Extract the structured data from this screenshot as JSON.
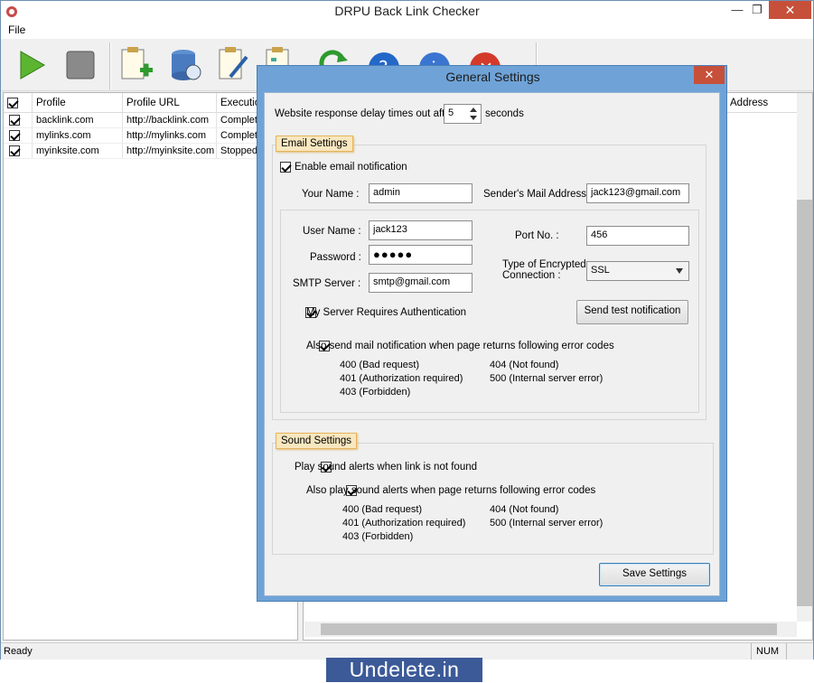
{
  "window": {
    "title": "DRPU Back Link Checker",
    "min_glyph": "—",
    "max_glyph": "❐",
    "close_glyph": "✕"
  },
  "menu": {
    "file": "File"
  },
  "toolbar": {
    "icons": [
      "start-icon",
      "stop-icon",
      "add-profile-icon",
      "database-icon",
      "edit-profile-icon",
      "report-icon",
      "refresh-icon",
      "help-icon",
      "about-icon",
      "exit-icon"
    ]
  },
  "grid": {
    "headers": {
      "profile": "Profile",
      "url": "Profile URL",
      "execution": "Executio",
      "address": "Address"
    },
    "rows": [
      {
        "checked": true,
        "profile": "backlink.com",
        "url": "http://backlink.com",
        "status": "Complete"
      },
      {
        "checked": true,
        "profile": "mylinks.com",
        "url": "http://mylinks.com",
        "status": "Complete"
      },
      {
        "checked": true,
        "profile": "myinksite.com",
        "url": "http://myinksite.com",
        "status": "Stopped"
      }
    ]
  },
  "status": {
    "left": "Ready",
    "right": "NUM"
  },
  "dialog": {
    "title": "General Settings",
    "close_glyph": "✕",
    "delay": {
      "label": "Website response delay times out after",
      "value": "5",
      "unit": "seconds"
    },
    "email": {
      "legend": "Email Settings",
      "enable": {
        "label": "Enable email notification",
        "checked": true
      },
      "your_name_label": "Your Name :",
      "your_name": "admin",
      "sender_label": "Sender's Mail Address :",
      "sender": "jack123@gmail.com",
      "user_label": "User Name :",
      "user": "jack123",
      "password_label": "Password :",
      "password": "●●●●●",
      "smtp_label": "SMTP Server :",
      "smtp": "smtp@gmail.com",
      "port_label": "Port No.  :",
      "port": "456",
      "enc_label": "Type of Encrypted Connection :",
      "enc": "SSL",
      "auth": {
        "label": "My Server Requires Authentication",
        "checked": true
      },
      "test_button": "Send test notification",
      "codes_check": {
        "label": "Also send mail notification when page returns following error codes",
        "checked": true
      },
      "codes_left": [
        "400 (Bad request)",
        "401 (Authorization required)",
        "403 (Forbidden)"
      ],
      "codes_right": [
        "404 (Not found)",
        "500 (Internal server error)"
      ]
    },
    "sound": {
      "legend": "Sound Settings",
      "play": {
        "label": "Play sound alerts when link is not found",
        "checked": true
      },
      "codes_check": {
        "label": "Also play sound alerts when page returns following error codes",
        "checked": true
      },
      "codes_left": [
        "400 (Bad request)",
        "401 (Authorization required)",
        "403 (Forbidden)"
      ],
      "codes_right": [
        "404 (Not found)",
        "500 (Internal server error)"
      ]
    },
    "save_button": "Save Settings"
  },
  "brand": "Undelete.in"
}
